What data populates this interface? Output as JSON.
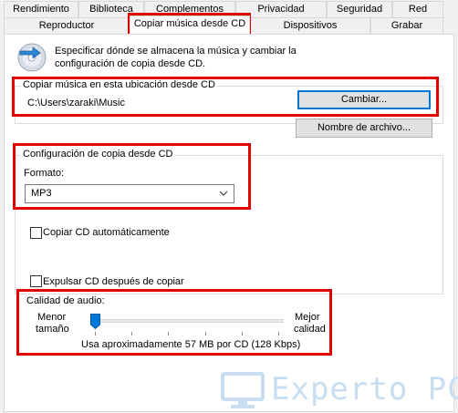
{
  "tabs": {
    "row1": [
      "Rendimiento",
      "Biblioteca",
      "Complementos",
      "Privacidad",
      "Seguridad",
      "Red"
    ],
    "row2": [
      "Reproductor",
      "Copiar música desde CD",
      "Dispositivos",
      "Grabar"
    ],
    "active": "Copiar música desde CD"
  },
  "intro": {
    "icon": "cd-rip-icon",
    "line1": "Especificar dónde se almacena la música y cambiar la",
    "line2": "configuración de copia desde CD."
  },
  "location": {
    "title": "Copiar música en esta ubicación desde CD",
    "path": "C:\\Users\\zaraki\\Music",
    "change_label": "Cambiar...",
    "filename_label": "Nombre de archivo..."
  },
  "settings": {
    "title": "Configuración de copia desde CD",
    "format_label": "Formato:",
    "format_value": "MP3",
    "auto_copy_label": "Copiar CD automáticamente",
    "auto_copy_checked": false,
    "eject_label": "Expulsar CD después de copiar",
    "eject_checked": false
  },
  "quality": {
    "title": "Calidad de audio:",
    "min_line1": "Menor",
    "min_line2": "tamaño",
    "max_line1": "Mejor",
    "max_line2": "calidad",
    "usage": "Usa aproximadamente 57 MB por CD (128 Kbps)",
    "slider_level": 0.0
  },
  "watermark": {
    "text": "Experto PC",
    "icon": "monitor-icon"
  },
  "colors": {
    "highlight": "#e00000",
    "focus": "#0078d7",
    "watermark": "#c9ddf0"
  }
}
